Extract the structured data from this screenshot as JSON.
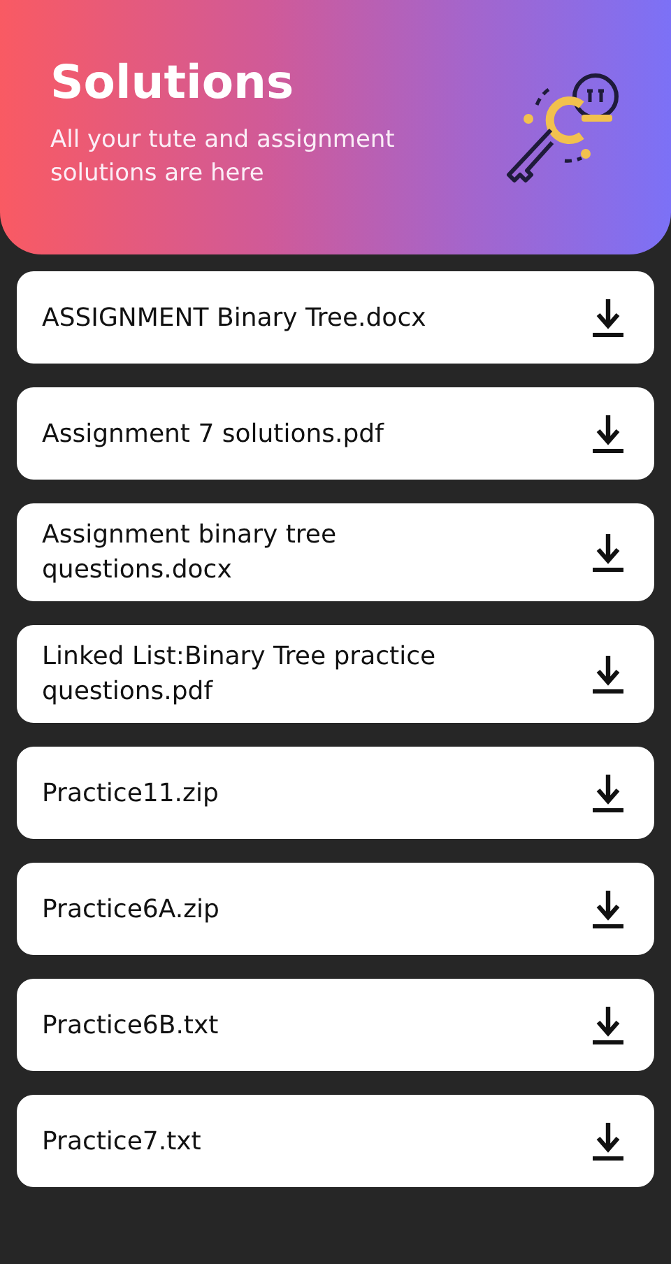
{
  "header": {
    "title": "Solutions",
    "subtitle": "All your tute and assignment solutions are here"
  },
  "files": [
    {
      "name": "ASSIGNMENT Binary Tree.docx"
    },
    {
      "name": "Assignment 7 solutions.pdf"
    },
    {
      "name": "Assignment binary tree questions.docx"
    },
    {
      "name": "Linked List:Binary Tree practice questions.pdf"
    },
    {
      "name": "Practice11.zip"
    },
    {
      "name": "Practice6A.zip"
    },
    {
      "name": "Practice6B.txt"
    },
    {
      "name": "Practice7.txt"
    }
  ]
}
